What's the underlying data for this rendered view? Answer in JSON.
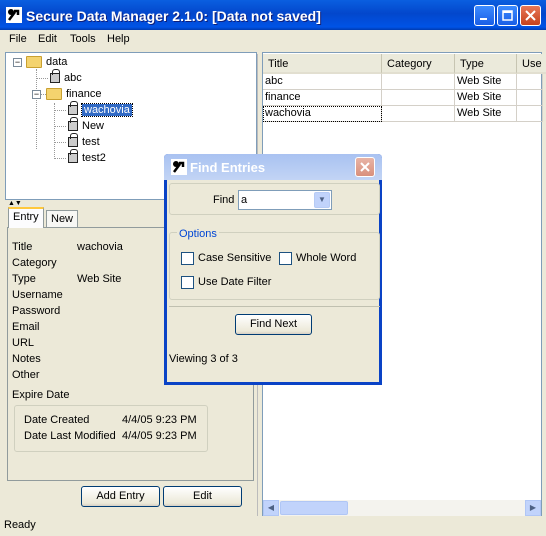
{
  "window": {
    "title": "Secure Data Manager 2.1.0: [Data not saved]"
  },
  "menu": [
    "File",
    "Edit",
    "Tools",
    "Help"
  ],
  "tree": {
    "root": "data",
    "items": [
      {
        "label": "abc",
        "type": "entry"
      },
      {
        "label": "finance",
        "type": "folder"
      },
      {
        "label": "wachovia",
        "type": "entry",
        "selected": true
      },
      {
        "label": "New",
        "type": "entry"
      },
      {
        "label": "test",
        "type": "entry"
      },
      {
        "label": "test2",
        "type": "entry"
      }
    ]
  },
  "tabs": [
    "Entry",
    "New"
  ],
  "entry": {
    "fields": [
      {
        "label": "Title",
        "value": "wachovia"
      },
      {
        "label": "Category",
        "value": ""
      },
      {
        "label": "Type",
        "value": "Web Site"
      },
      {
        "label": "Username",
        "value": ""
      },
      {
        "label": "Password",
        "value": ""
      },
      {
        "label": "Email",
        "value": ""
      },
      {
        "label": "URL",
        "value": ""
      },
      {
        "label": "Notes",
        "value": ""
      },
      {
        "label": "Other",
        "value": ""
      }
    ],
    "expire_label": "Expire Date",
    "date_created_label": "Date Created",
    "date_created": "4/4/05 9:23 PM",
    "date_modified_label": "Date Last Modified",
    "date_modified": "4/4/05 9:23 PM",
    "add_button": "Add Entry",
    "edit_button": "Edit"
  },
  "table": {
    "columns": [
      "Title",
      "Category",
      "Type",
      "Use"
    ],
    "rows": [
      [
        "abc",
        "",
        "Web Site",
        ""
      ],
      [
        "finance",
        "",
        "Web Site",
        ""
      ],
      [
        "wachovia",
        "",
        "Web Site",
        ""
      ]
    ]
  },
  "status": "Ready",
  "find_dialog": {
    "title": "Find Entries",
    "find_label": "Find",
    "find_value": "a",
    "options_label": "Options",
    "case_sensitive": "Case Sensitive",
    "whole_word": "Whole Word",
    "use_date_filter": "Use Date Filter",
    "find_next": "Find Next",
    "viewing": "Viewing 3 of 3"
  }
}
